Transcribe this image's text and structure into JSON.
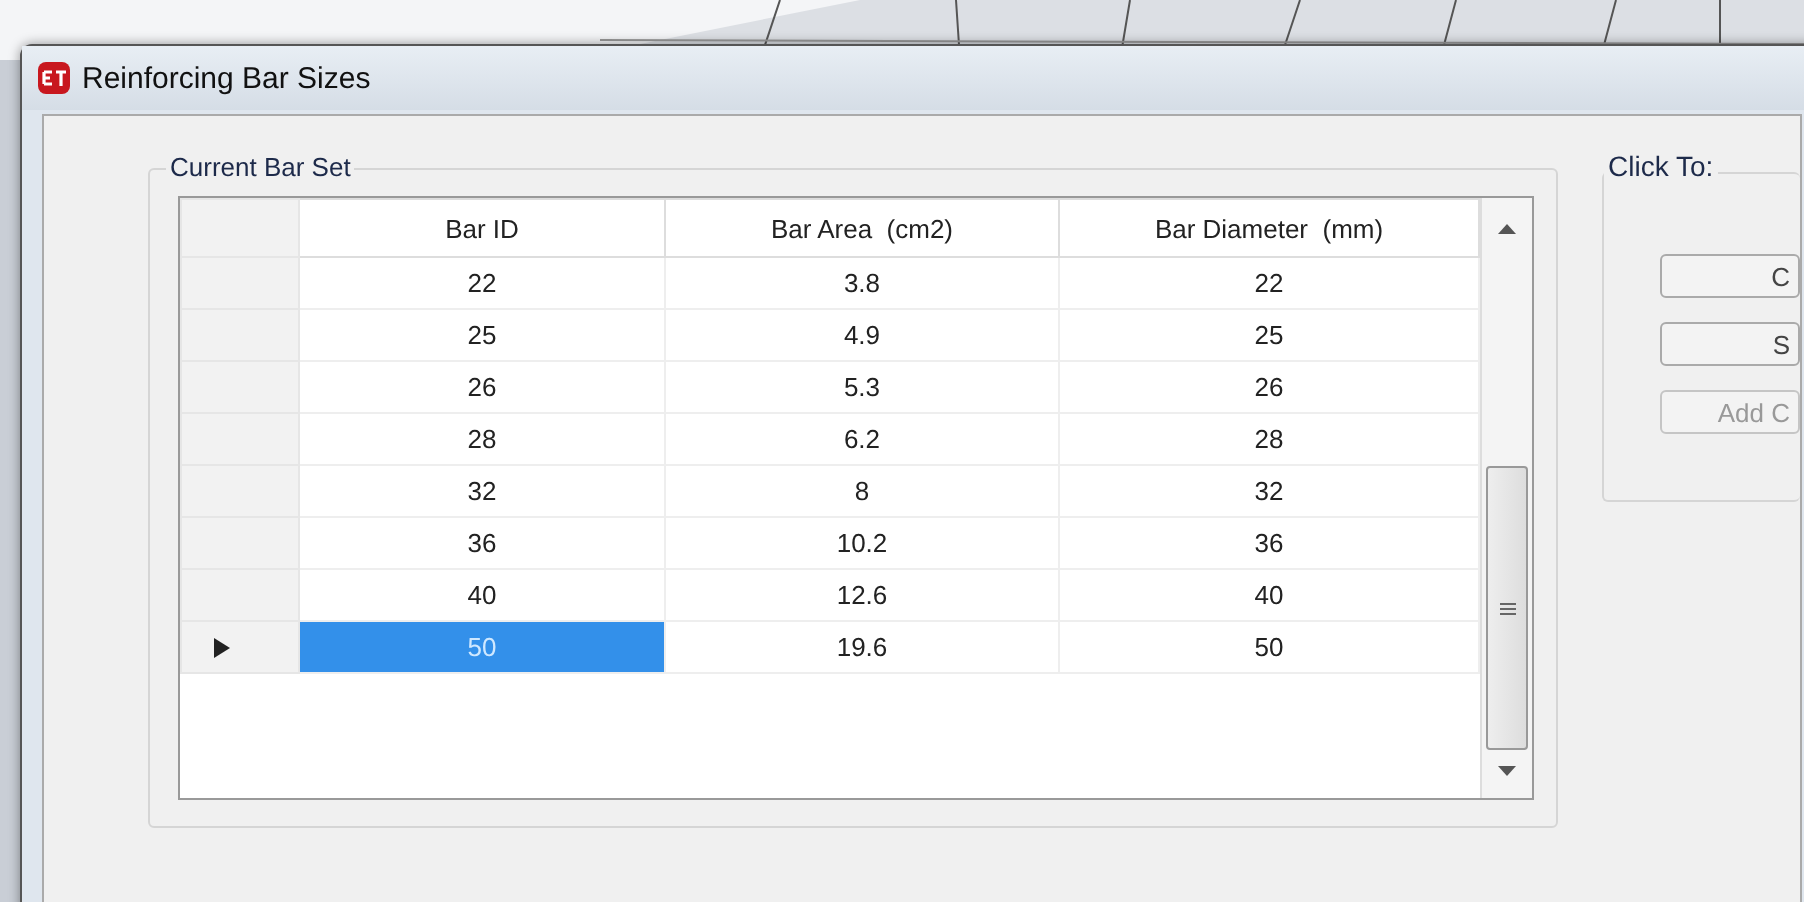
{
  "window": {
    "title": "Reinforcing Bar Sizes"
  },
  "current_bar_set": {
    "title": "Current Bar Set",
    "table": {
      "columns": [
        "Bar ID",
        "Bar Area  (cm2)",
        "Bar Diameter  (mm)"
      ],
      "rows": [
        {
          "cells": [
            "22",
            "3.8",
            "22"
          ],
          "selected": false
        },
        {
          "cells": [
            "25",
            "4.9",
            "25"
          ],
          "selected": false
        },
        {
          "cells": [
            "26",
            "5.3",
            "26"
          ],
          "selected": false
        },
        {
          "cells": [
            "28",
            "6.2",
            "28"
          ],
          "selected": false
        },
        {
          "cells": [
            "32",
            "8",
            "32"
          ],
          "selected": false
        },
        {
          "cells": [
            "36",
            "10.2",
            "36"
          ],
          "selected": false
        },
        {
          "cells": [
            "40",
            "12.6",
            "40"
          ],
          "selected": false
        },
        {
          "cells": [
            "50",
            "19.6",
            "50"
          ],
          "selected": true
        }
      ]
    }
  },
  "click_to": {
    "title": "Click To:",
    "buttons": [
      {
        "label": "C",
        "disabled": false
      },
      {
        "label": "S",
        "disabled": false
      },
      {
        "label": "Add C",
        "disabled": true
      }
    ]
  }
}
